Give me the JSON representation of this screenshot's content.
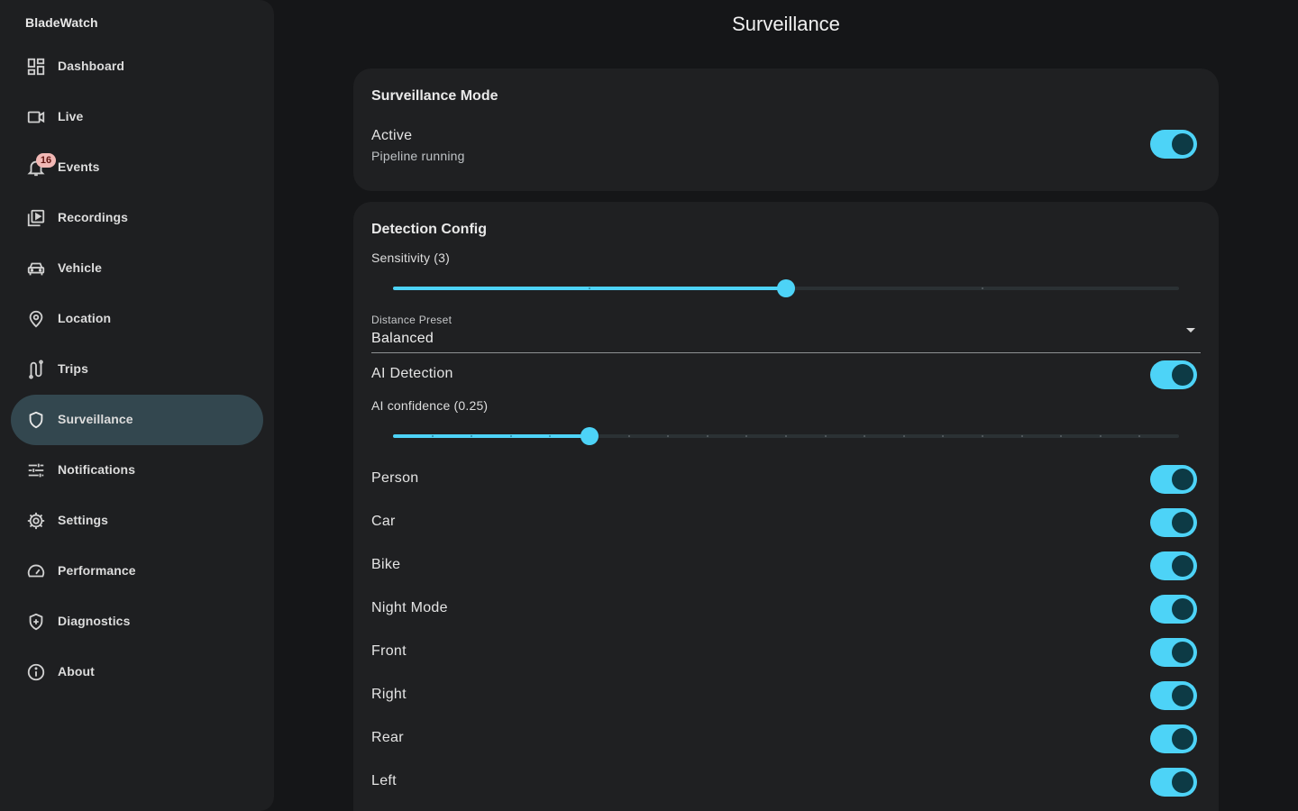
{
  "app": {
    "brand": "BladeWatch"
  },
  "sidebar": {
    "items": [
      {
        "label": "Dashboard",
        "icon": "dashboard-icon"
      },
      {
        "label": "Live",
        "icon": "videocam-icon"
      },
      {
        "label": "Events",
        "icon": "bell-icon",
        "badge": "16"
      },
      {
        "label": "Recordings",
        "icon": "video-library-icon"
      },
      {
        "label": "Vehicle",
        "icon": "car-icon"
      },
      {
        "label": "Location",
        "icon": "location-pin-icon"
      },
      {
        "label": "Trips",
        "icon": "route-icon"
      },
      {
        "label": "Surveillance",
        "icon": "shield-icon",
        "active": true
      },
      {
        "label": "Notifications",
        "icon": "tune-icon"
      },
      {
        "label": "Settings",
        "icon": "gear-icon"
      },
      {
        "label": "Performance",
        "icon": "speed-icon"
      },
      {
        "label": "Diagnostics",
        "icon": "health-shield-icon"
      },
      {
        "label": "About",
        "icon": "info-icon"
      }
    ]
  },
  "page": {
    "title": "Surveillance"
  },
  "mode_card": {
    "title": "Surveillance Mode",
    "active_label": "Active",
    "active_sub": "Pipeline running",
    "active_on": true
  },
  "detection": {
    "title": "Detection Config",
    "sensitivity_label": "Sensitivity (3)",
    "sensitivity": {
      "value": 3,
      "min": 1,
      "max": 5,
      "fraction": 0.5,
      "divisions": 4
    },
    "distance": {
      "label": "Distance Preset",
      "value": "Balanced"
    },
    "ai_detection_label": "AI Detection",
    "ai_detection_on": true,
    "ai_confidence_label": "AI confidence (0.25)",
    "ai_confidence": {
      "value": 0.25,
      "fraction": 0.25,
      "divisions": 20
    },
    "toggles": [
      {
        "label": "Person",
        "on": true
      },
      {
        "label": "Car",
        "on": true
      },
      {
        "label": "Bike",
        "on": true
      },
      {
        "label": "Night Mode",
        "on": true
      },
      {
        "label": "Front",
        "on": true
      },
      {
        "label": "Right",
        "on": true
      },
      {
        "label": "Rear",
        "on": true
      },
      {
        "label": "Left",
        "on": true
      }
    ]
  },
  "colors": {
    "accent": "#4dd3f7",
    "knob": "#0d3a45",
    "active_nav": "#33474f",
    "card": "#1f2022"
  }
}
